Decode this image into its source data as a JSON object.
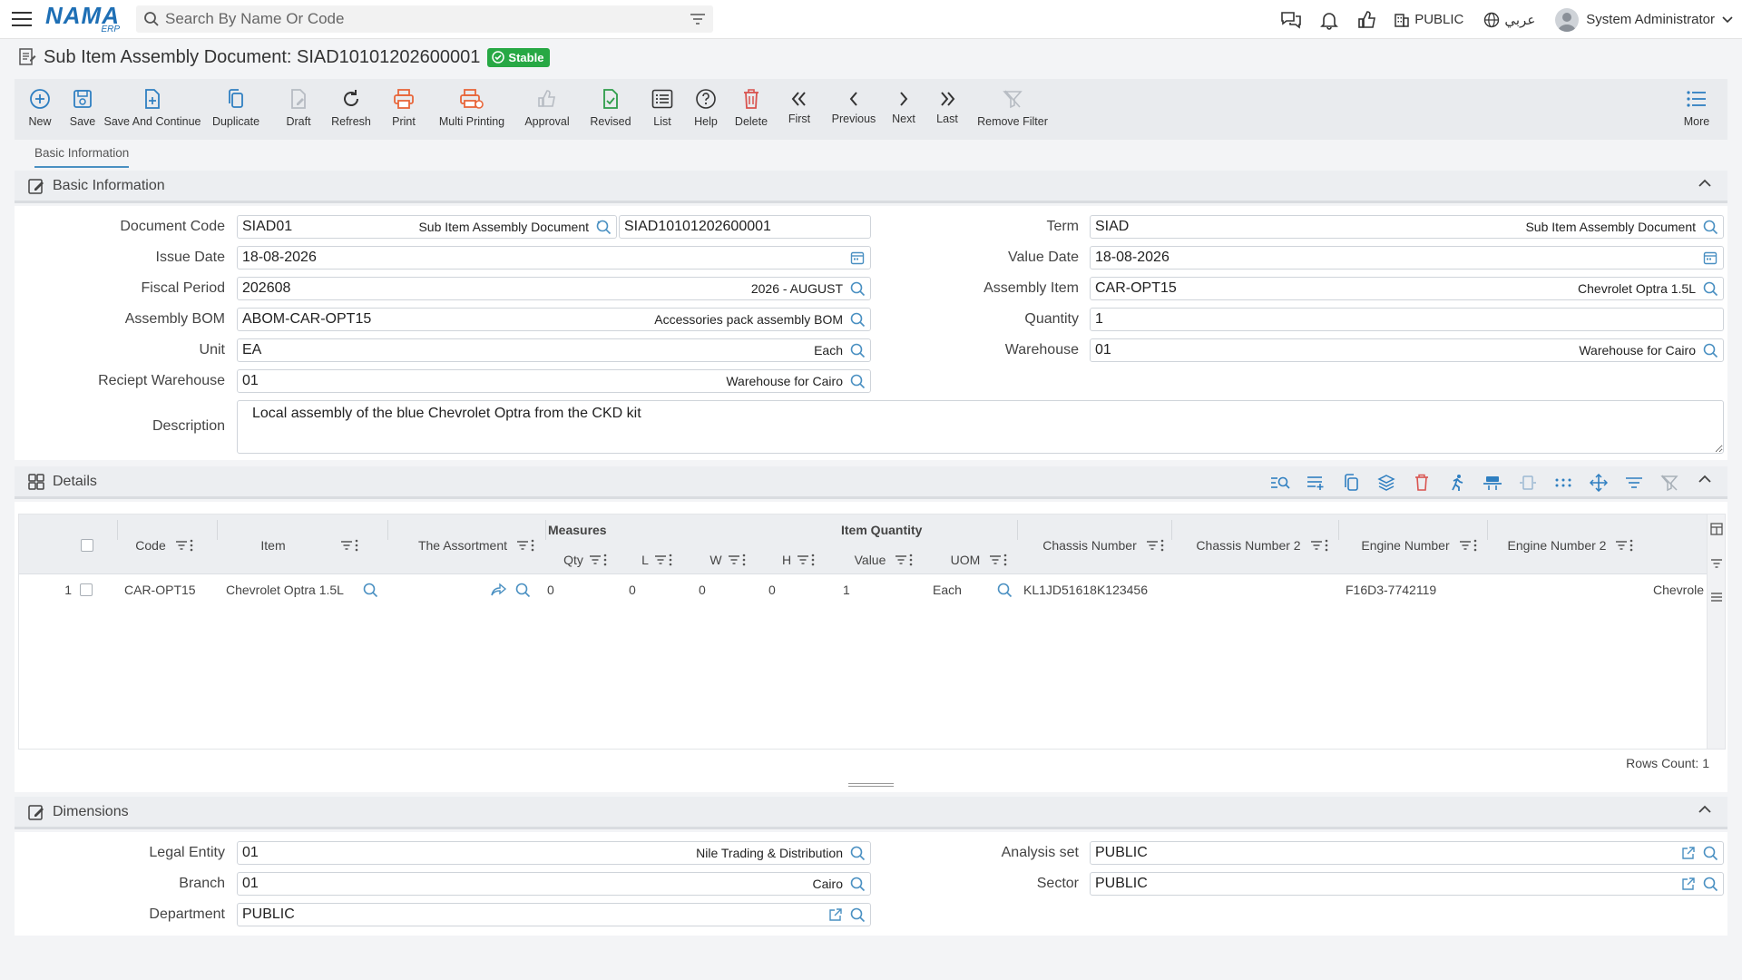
{
  "app": {
    "logo_text": "NAMA",
    "logo_sub": "ERP"
  },
  "search": {
    "placeholder": "Search By Name Or Code"
  },
  "topbar": {
    "analysis": "PUBLIC",
    "language": "عربي",
    "user": "System Administrator"
  },
  "page": {
    "title": "Sub Item Assembly Document: SIAD10101202600001",
    "status": "Stable"
  },
  "toolbar": {
    "new": "New",
    "save": "Save",
    "save_continue": "Save And Continue",
    "duplicate": "Duplicate",
    "draft": "Draft",
    "refresh": "Refresh",
    "print": "Print",
    "multi_printing": "Multi Printing",
    "approval": "Approval",
    "revised": "Revised",
    "list": "List",
    "help": "Help",
    "delete": "Delete",
    "first": "First",
    "previous": "Previous",
    "next": "Next",
    "last": "Last",
    "remove_filter": "Remove Filter",
    "more": "More"
  },
  "tabs": {
    "basic": "Basic Information"
  },
  "basic": {
    "title": "Basic Information",
    "document_code": {
      "label": "Document Code",
      "value": "SIAD01",
      "desc": "Sub Item Assembly Document",
      "number": "SIAD10101202600001"
    },
    "term": {
      "label": "Term",
      "value": "SIAD",
      "desc": "Sub Item Assembly Document"
    },
    "issue_date": {
      "label": "Issue Date",
      "value": "18-08-2026"
    },
    "value_date": {
      "label": "Value Date",
      "value": "18-08-2026"
    },
    "fiscal_period": {
      "label": "Fiscal Period",
      "value": "202608",
      "desc": "2026 - AUGUST"
    },
    "assembly_item": {
      "label": "Assembly Item",
      "value": "CAR-OPT15",
      "desc": "Chevrolet Optra 1.5L"
    },
    "assembly_bom": {
      "label": "Assembly BOM",
      "value": "ABOM-CAR-OPT15",
      "desc": "Accessories pack assembly BOM"
    },
    "quantity": {
      "label": "Quantity",
      "value": "1"
    },
    "unit": {
      "label": "Unit",
      "value": "EA",
      "desc": "Each"
    },
    "warehouse": {
      "label": "Warehouse",
      "value": "01",
      "desc": "Warehouse for Cairo"
    },
    "receipt_warehouse": {
      "label": "Reciept Warehouse",
      "value": "01",
      "desc": "Warehouse for Cairo"
    },
    "description": {
      "label": "Description",
      "value": "Local assembly of the blue Chevrolet Optra from the CKD kit"
    }
  },
  "details": {
    "title": "Details",
    "groups": {
      "measures": "Measures",
      "item_quantity": "Item Quantity"
    },
    "columns": {
      "code": "Code",
      "item": "Item",
      "assortment": "The Assortment",
      "qty": "Qty",
      "l": "L",
      "w": "W",
      "h": "H",
      "value": "Value",
      "uom": "UOM",
      "chassis": "Chassis Number",
      "chassis2": "Chassis Number 2",
      "engine": "Engine Number",
      "engine2": "Engine Number 2"
    },
    "rows": [
      {
        "num": "1",
        "code": "CAR-OPT15",
        "item": "Chevrolet Optra 1.5L",
        "qty": "0",
        "l": "0",
        "w": "0",
        "h": "0",
        "value": "1",
        "uom": "Each",
        "chassis": "KL1JD51618K123456",
        "chassis2": "",
        "engine": "F16D3-7742119",
        "engine2": "",
        "extra": "Chevrole"
      }
    ],
    "rows_count": "Rows Count: 1"
  },
  "dimensions": {
    "title": "Dimensions",
    "legal_entity": {
      "label": "Legal Entity",
      "value": "01",
      "desc": "Nile Trading & Distribution"
    },
    "analysis_set": {
      "label": "Analysis set",
      "value": "PUBLIC"
    },
    "branch": {
      "label": "Branch",
      "value": "01",
      "desc": "Cairo"
    },
    "sector": {
      "label": "Sector",
      "value": "PUBLIC"
    },
    "department": {
      "label": "Department",
      "value": "PUBLIC"
    }
  },
  "colors": {
    "accent": "#4a90c2",
    "status": "#27a844",
    "delete": "#d9534f",
    "print": "#e8663a"
  }
}
